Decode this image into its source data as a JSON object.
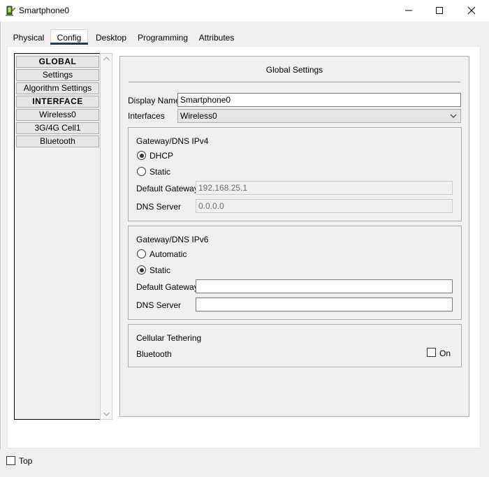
{
  "window": {
    "title": "Smartphone0",
    "icon": "smartphone-app-icon",
    "controls": [
      "minimize",
      "maximize",
      "close"
    ]
  },
  "tabs": [
    {
      "label": "Physical",
      "active": false
    },
    {
      "label": "Config",
      "active": true
    },
    {
      "label": "Desktop",
      "active": false
    },
    {
      "label": "Programming",
      "active": false
    },
    {
      "label": "Attributes",
      "active": false
    }
  ],
  "sidebar": {
    "items": [
      {
        "label": "GLOBAL",
        "header": true
      },
      {
        "label": "Settings",
        "header": false
      },
      {
        "label": "Algorithm Settings",
        "header": false
      },
      {
        "label": "INTERFACE",
        "header": true
      },
      {
        "label": "Wireless0",
        "header": false
      },
      {
        "label": "3G/4G Cell1",
        "header": false
      },
      {
        "label": "Bluetooth",
        "header": false
      }
    ]
  },
  "main": {
    "title": "Global Settings",
    "display_name_label": "Display Name",
    "display_name_value": "Smartphone0",
    "interfaces_label": "Interfaces",
    "interfaces_value": "Wireless0",
    "ipv4": {
      "title": "Gateway/DNS IPv4",
      "dhcp_label": "DHCP",
      "dhcp_selected": true,
      "static_label": "Static",
      "static_selected": false,
      "gateway_label": "Default Gateway",
      "gateway_value": "192.168.25.1",
      "dns_label": "DNS Server",
      "dns_value": "0.0.0.0"
    },
    "ipv6": {
      "title": "Gateway/DNS IPv6",
      "automatic_label": "Automatic",
      "automatic_selected": false,
      "static_label": "Static",
      "static_selected": true,
      "gateway_label": "Default Gateway",
      "gateway_value": "",
      "dns_label": "DNS Server",
      "dns_value": ""
    },
    "tethering": {
      "title": "Cellular Tethering",
      "bluetooth_label": "Bluetooth",
      "on_label": "On",
      "on_checked": false
    }
  },
  "footer": {
    "top_label": "Top",
    "top_checked": false
  },
  "colors": {
    "tab_underline": "#1e3a5f",
    "window_bg": "#f0f0f0",
    "panel_border": "#adadad"
  }
}
